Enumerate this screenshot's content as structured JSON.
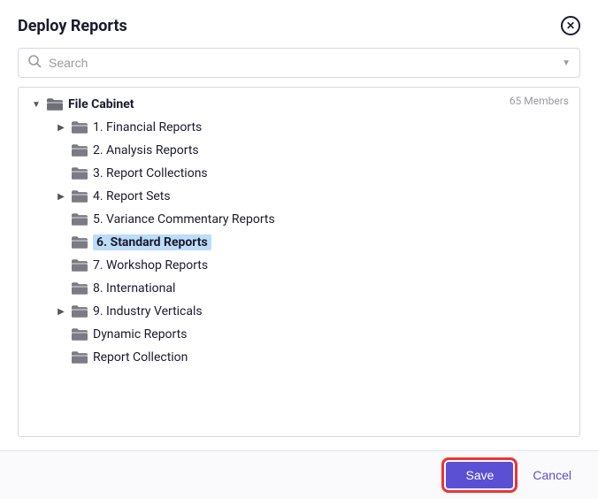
{
  "dialog": {
    "title": "Deploy Reports",
    "members_label": "65 Members"
  },
  "search": {
    "placeholder": "Search"
  },
  "tree": {
    "root": {
      "label": "File Cabinet",
      "expanded": true
    },
    "children": [
      {
        "label": "1. Financial Reports",
        "expandable": true,
        "expanded": false,
        "selected": false
      },
      {
        "label": "2. Analysis Reports",
        "expandable": false,
        "selected": false
      },
      {
        "label": "3. Report Collections",
        "expandable": false,
        "selected": false
      },
      {
        "label": "4. Report Sets",
        "expandable": true,
        "expanded": false,
        "selected": false
      },
      {
        "label": "5. Variance Commentary Reports",
        "expandable": false,
        "selected": false
      },
      {
        "label": "6. Standard Reports",
        "expandable": false,
        "selected": true
      },
      {
        "label": "7. Workshop Reports",
        "expandable": false,
        "selected": false
      },
      {
        "label": "8. International",
        "expandable": false,
        "selected": false
      },
      {
        "label": "9. Industry Verticals",
        "expandable": true,
        "expanded": false,
        "selected": false
      },
      {
        "label": "Dynamic Reports",
        "expandable": false,
        "selected": false
      },
      {
        "label": "Report Collection",
        "expandable": false,
        "selected": false
      }
    ]
  },
  "footer": {
    "save_label": "Save",
    "cancel_label": "Cancel"
  },
  "colors": {
    "accent": "#5b4fd4",
    "highlight_outline": "#e33",
    "selection_bg": "#bcdcf7"
  }
}
